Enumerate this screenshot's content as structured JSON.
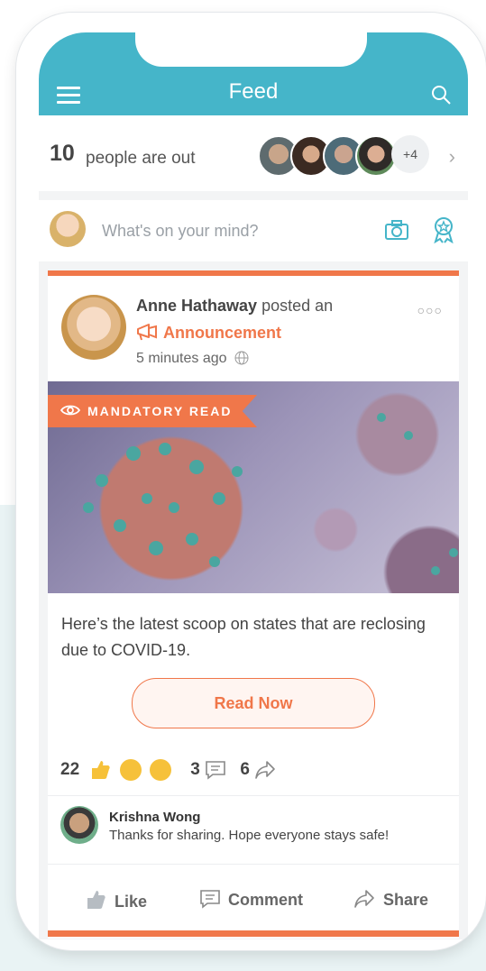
{
  "header": {
    "title": "Feed"
  },
  "people_out": {
    "count": "10",
    "label": "people are out",
    "extra": "+4"
  },
  "composer": {
    "placeholder": "What's on your mind?"
  },
  "post": {
    "author": "Anne Hathaway",
    "action": "posted an",
    "type": "Announcement",
    "time": "5 minutes ago",
    "banner": "MANDATORY READ",
    "text": "Here’s the latest scoop on states that are reclosing due to COVID-19.",
    "cta": "Read Now",
    "reaction_count": "22",
    "comment_count": "3",
    "share_count": "6"
  },
  "comment": {
    "name": "Krishna Wong",
    "text": "Thanks for sharing. Hope everyone stays safe!"
  },
  "actions": {
    "like": "Like",
    "comment": "Comment",
    "share": "Share"
  },
  "colors": {
    "header": "#45b5c9",
    "accent": "#f0774a"
  },
  "icons": [
    "hamburger-icon",
    "search-icon",
    "chevron-right-icon",
    "camera-icon",
    "award-icon",
    "megaphone-icon",
    "globe-icon",
    "more-icon",
    "eye-icon",
    "like-icon",
    "comment-icon",
    "share-icon"
  ]
}
